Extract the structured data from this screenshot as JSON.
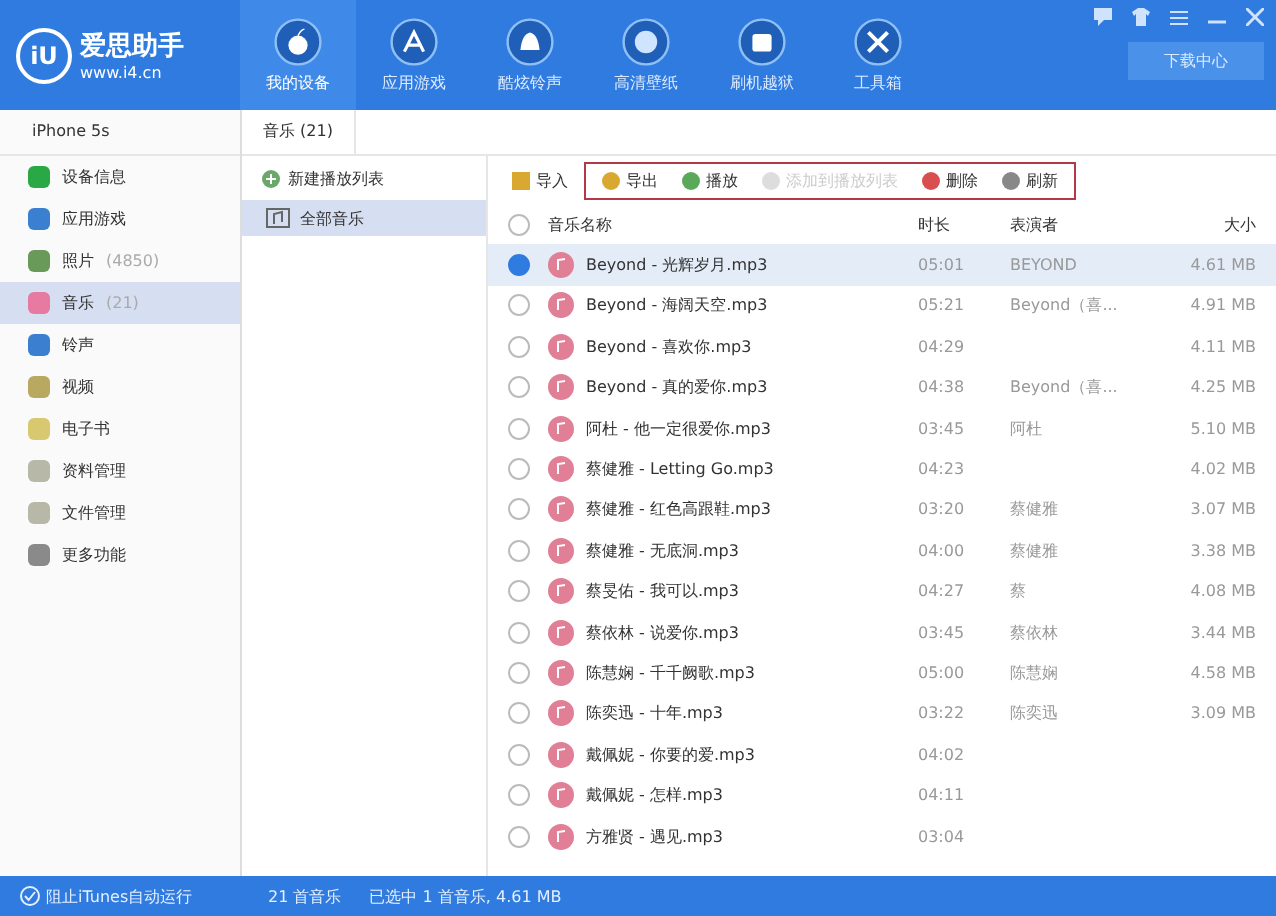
{
  "app": {
    "logo": "iU",
    "name": "爱思助手",
    "url": "www.i4.cn"
  },
  "nav": [
    {
      "label": "我的设备",
      "selected": true
    },
    {
      "label": "应用游戏",
      "selected": false
    },
    {
      "label": "酷炫铃声",
      "selected": false
    },
    {
      "label": "高清壁纸",
      "selected": false
    },
    {
      "label": "刷机越狱",
      "selected": false
    },
    {
      "label": "工具箱",
      "selected": false
    }
  ],
  "header_button": "下载中心",
  "device": "iPhone 5s",
  "sidebar": [
    {
      "label": "设备信息",
      "selected": false
    },
    {
      "label": "应用游戏",
      "selected": false
    },
    {
      "label": "照片",
      "count": "(4850)",
      "selected": false
    },
    {
      "label": "音乐",
      "count": "(21)",
      "selected": true
    },
    {
      "label": "铃声",
      "selected": false
    },
    {
      "label": "视频",
      "selected": false
    },
    {
      "label": "电子书",
      "selected": false
    },
    {
      "label": "资料管理",
      "selected": false
    },
    {
      "label": "文件管理",
      "selected": false
    },
    {
      "label": "更多功能",
      "selected": false
    }
  ],
  "tab": "音乐 (21)",
  "playlists": {
    "new": "新建播放列表",
    "items": [
      {
        "label": "全部音乐",
        "selected": true
      }
    ]
  },
  "toolbar": {
    "import": "导入",
    "actions": [
      {
        "label": "导出",
        "disabled": false
      },
      {
        "label": "播放",
        "disabled": false
      },
      {
        "label": "添加到播放列表",
        "disabled": true
      },
      {
        "label": "删除",
        "disabled": false
      },
      {
        "label": "刷新",
        "disabled": false
      }
    ]
  },
  "table": {
    "columns": [
      "音乐名称",
      "时长",
      "表演者",
      "大小"
    ],
    "all_checked": false,
    "rows": [
      {
        "name": "Beyond - 光辉岁月.mp3",
        "time": "05:01",
        "artist": "BEYOND",
        "size": "4.61 MB",
        "checked": true
      },
      {
        "name": "Beyond - 海阔天空.mp3",
        "time": "05:21",
        "artist": "Beyond（喜...",
        "size": "4.91 MB",
        "checked": false
      },
      {
        "name": "Beyond - 喜欢你.mp3",
        "time": "04:29",
        "size": "4.11 MB",
        "checked": false
      },
      {
        "name": "Beyond - 真的爱你.mp3",
        "time": "04:38",
        "artist": "Beyond（喜...",
        "size": "4.25 MB",
        "checked": false
      },
      {
        "name": "阿杜 - 他一定很爱你.mp3",
        "time": "03:45",
        "artist": "阿杜",
        "size": "5.10 MB",
        "checked": false
      },
      {
        "name": "蔡健雅 - Letting Go.mp3",
        "time": "04:23",
        "size": "4.02 MB",
        "checked": false
      },
      {
        "name": "蔡健雅 - 红色高跟鞋.mp3",
        "time": "03:20",
        "artist": "蔡健雅",
        "size": "3.07 MB",
        "checked": false
      },
      {
        "name": "蔡健雅 - 无底洞.mp3",
        "time": "04:00",
        "artist": "蔡健雅",
        "size": "3.38 MB",
        "checked": false
      },
      {
        "name": "蔡旻佑 - 我可以.mp3",
        "time": "04:27",
        "artist": "蔡",
        "size": "4.08 MB",
        "checked": false
      },
      {
        "name": "蔡依林 - 说爱你.mp3",
        "time": "03:45",
        "artist": "蔡依林",
        "size": "3.44 MB",
        "checked": false
      },
      {
        "name": "陈慧娴 - 千千阙歌.mp3",
        "time": "05:00",
        "artist": "陈慧娴",
        "size": "4.58 MB",
        "checked": false
      },
      {
        "name": "陈奕迅 - 十年.mp3",
        "time": "03:22",
        "artist": "陈奕迅",
        "size": "3.09 MB",
        "checked": false
      },
      {
        "name": "戴佩妮 - 你要的爱.mp3",
        "time": "04:02",
        "checked": false
      },
      {
        "name": "戴佩妮 - 怎样.mp3",
        "time": "04:11",
        "checked": false
      },
      {
        "name": "方雅贤 - 遇见.mp3",
        "time": "03:04",
        "checked": false
      }
    ]
  },
  "status_bar": {
    "itunes": {
      "label": "阻止iTunes自动运行",
      "checked": true
    },
    "count": "21 首音乐",
    "selection": "已选中 1 首音乐, 4.61 MB"
  }
}
